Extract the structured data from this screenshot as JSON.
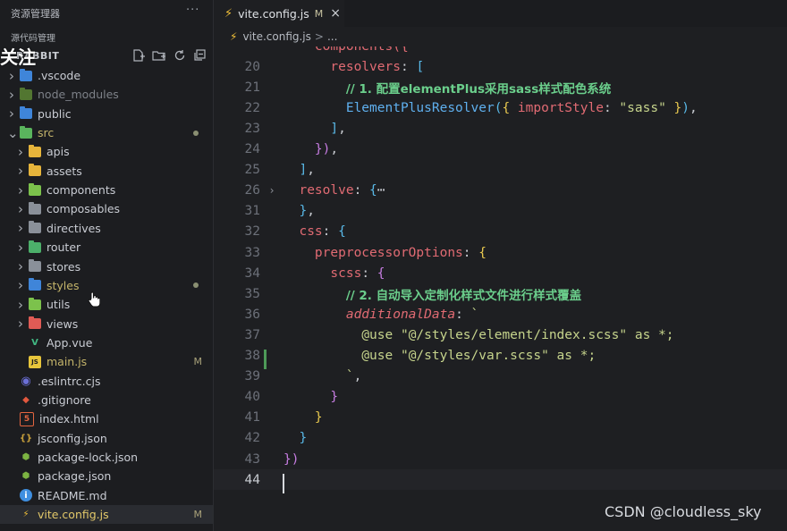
{
  "sidebar": {
    "title": "资源管理器",
    "more": "···",
    "source_control": "源代码管理",
    "overlay_follow": "关注",
    "project": "RABBIT",
    "tree": [
      {
        "label": ".vscode",
        "type": "folder",
        "depth": 0,
        "expanded": false,
        "color": "#3f85d9",
        "dim": false
      },
      {
        "label": "node_modules",
        "type": "folder",
        "depth": 0,
        "expanded": false,
        "color": "#7fbf3f",
        "dim": true
      },
      {
        "label": "public",
        "type": "folder",
        "depth": 0,
        "expanded": false,
        "color": "#3f85d9",
        "dim": false
      },
      {
        "label": "src",
        "type": "folder",
        "depth": 0,
        "expanded": true,
        "color": "#5ab55d",
        "dim": false,
        "status": "dot",
        "accent": "#c4b46a"
      },
      {
        "label": "apis",
        "type": "folder",
        "depth": 1,
        "expanded": false,
        "color": "#e7b53b",
        "dim": false
      },
      {
        "label": "assets",
        "type": "folder",
        "depth": 1,
        "expanded": false,
        "color": "#e7b53b",
        "dim": false
      },
      {
        "label": "components",
        "type": "folder",
        "depth": 1,
        "expanded": false,
        "color": "#7cc24c",
        "dim": false
      },
      {
        "label": "composables",
        "type": "folder",
        "depth": 1,
        "expanded": false,
        "color": "#8a9099",
        "dim": false
      },
      {
        "label": "directives",
        "type": "folder",
        "depth": 1,
        "expanded": false,
        "color": "#8a9099",
        "dim": false
      },
      {
        "label": "router",
        "type": "folder",
        "depth": 1,
        "expanded": false,
        "color": "#4caf6a",
        "dim": false
      },
      {
        "label": "stores",
        "type": "folder",
        "depth": 1,
        "expanded": false,
        "color": "#8a9099",
        "dim": false
      },
      {
        "label": "styles",
        "type": "folder",
        "depth": 1,
        "expanded": false,
        "color": "#3f85d9",
        "dim": false,
        "status": "dot",
        "accent": "#c4b46a"
      },
      {
        "label": "utils",
        "type": "folder",
        "depth": 1,
        "expanded": false,
        "color": "#7cc24c",
        "dim": false
      },
      {
        "label": "views",
        "type": "folder",
        "depth": 1,
        "expanded": false,
        "color": "#e05b55",
        "dim": false
      },
      {
        "label": "App.vue",
        "type": "file",
        "depth": 1,
        "icon": "V",
        "color": "#41b883",
        "dim": false
      },
      {
        "label": "main.js",
        "type": "file",
        "depth": 1,
        "icon": "JS",
        "color": "#e7c53b",
        "dim": false,
        "status": "M",
        "accent": "#c4b46a"
      },
      {
        "label": ".eslintrc.cjs",
        "type": "file",
        "depth": 0,
        "icon": "◉",
        "color": "#6b6fd6",
        "dim": false
      },
      {
        "label": ".gitignore",
        "type": "file",
        "depth": 0,
        "icon": "◆",
        "color": "#e2583e",
        "dim": false
      },
      {
        "label": "index.html",
        "type": "file",
        "depth": 0,
        "icon": "5",
        "color": "#e3653f",
        "dim": false
      },
      {
        "label": "jsconfig.json",
        "type": "file",
        "depth": 0,
        "icon": "{}",
        "color": "#c9a13b",
        "dim": false
      },
      {
        "label": "package-lock.json",
        "type": "file",
        "depth": 0,
        "icon": "⬢",
        "color": "#7cb342",
        "dim": false
      },
      {
        "label": "package.json",
        "type": "file",
        "depth": 0,
        "icon": "⬢",
        "color": "#7cb342",
        "dim": false
      },
      {
        "label": "README.md",
        "type": "file",
        "depth": 0,
        "icon": "i",
        "color": "#3f8fe0",
        "dim": false
      },
      {
        "label": "vite.config.js",
        "type": "file",
        "depth": 0,
        "icon": "⚡",
        "color": "#f2c038",
        "dim": false,
        "status": "M",
        "accent": "#e3c96a",
        "selected": true
      }
    ]
  },
  "tab": {
    "label": "vite.config.js",
    "modified": "M",
    "close": "×"
  },
  "breadcrumb": {
    "file": "vite.config.js",
    "sep": ">",
    "rest": "..."
  },
  "code_lines": [
    {
      "n": "",
      "tokens": [
        [
          "    components({",
          "k"
        ]
      ]
    },
    {
      "n": "20",
      "tokens": [
        [
          "      ",
          "p"
        ],
        [
          "resolvers",
          "k"
        ],
        [
          ": ",
          "p"
        ],
        [
          "[",
          "b3"
        ]
      ]
    },
    {
      "n": "21",
      "tokens": [
        [
          "        ",
          "p"
        ],
        [
          "// 1. 配置elementPlus采用sass样式配色系统",
          "c"
        ]
      ]
    },
    {
      "n": "22",
      "tokens": [
        [
          "        ",
          "p"
        ],
        [
          "ElementPlusResolver",
          "fn"
        ],
        [
          "(",
          "b3"
        ],
        [
          "{",
          "b1"
        ],
        [
          " ",
          "p"
        ],
        [
          "importStyle",
          "k"
        ],
        [
          ": ",
          "p"
        ],
        [
          "\"sass\"",
          "s"
        ],
        [
          " ",
          "p"
        ],
        [
          "}",
          "b1"
        ],
        [
          ")",
          "b3"
        ],
        [
          ",",
          "p"
        ]
      ]
    },
    {
      "n": "23",
      "tokens": [
        [
          "      ",
          "p"
        ],
        [
          "]",
          "b3"
        ],
        [
          ",",
          "p"
        ]
      ]
    },
    {
      "n": "24",
      "tokens": [
        [
          "    ",
          "p"
        ],
        [
          "}",
          "b2"
        ],
        [
          ")",
          "b2"
        ],
        [
          ",",
          "p"
        ]
      ]
    },
    {
      "n": "25",
      "tokens": [
        [
          "  ",
          "p"
        ],
        [
          "]",
          "b3"
        ],
        [
          ",",
          "p"
        ]
      ]
    },
    {
      "n": "26",
      "fold": "›",
      "tokens": [
        [
          "  ",
          "p"
        ],
        [
          "resolve",
          "k"
        ],
        [
          ": ",
          "p"
        ],
        [
          "{",
          "b3"
        ],
        [
          "⋯",
          "p"
        ]
      ]
    },
    {
      "n": "31",
      "tokens": [
        [
          "  ",
          "p"
        ],
        [
          "}",
          "b3"
        ],
        [
          ",",
          "p"
        ]
      ]
    },
    {
      "n": "32",
      "tokens": [
        [
          "  ",
          "p"
        ],
        [
          "css",
          "k"
        ],
        [
          ": ",
          "p"
        ],
        [
          "{",
          "b3"
        ]
      ]
    },
    {
      "n": "33",
      "tokens": [
        [
          "    ",
          "p"
        ],
        [
          "preprocessorOptions",
          "k"
        ],
        [
          ": ",
          "p"
        ],
        [
          "{",
          "b1"
        ]
      ]
    },
    {
      "n": "34",
      "tokens": [
        [
          "      ",
          "p"
        ],
        [
          "scss",
          "k"
        ],
        [
          ": ",
          "p"
        ],
        [
          "{",
          "b2"
        ]
      ]
    },
    {
      "n": "35",
      "tokens": [
        [
          "        ",
          "p"
        ],
        [
          "// 2. 自动导入定制化样式文件进行样式覆盖",
          "c"
        ]
      ]
    },
    {
      "n": "36",
      "tokens": [
        [
          "        ",
          "p"
        ],
        [
          "additionalData",
          "k it"
        ],
        [
          ": ",
          "p"
        ],
        [
          "`",
          "s"
        ]
      ]
    },
    {
      "n": "37",
      "tokens": [
        [
          "          ",
          "p"
        ],
        [
          "@use \"@/styles/element/index.scss\" as *;",
          "s"
        ]
      ]
    },
    {
      "n": "38",
      "tokens": [
        [
          "          ",
          "p"
        ],
        [
          "@use \"@/styles/var.scss\" as *;",
          "s"
        ]
      ]
    },
    {
      "n": "39",
      "tokens": [
        [
          "        ",
          "p"
        ],
        [
          "`",
          "s"
        ],
        [
          ",",
          "p"
        ]
      ]
    },
    {
      "n": "40",
      "tokens": [
        [
          "      ",
          "p"
        ],
        [
          "}",
          "b2"
        ]
      ]
    },
    {
      "n": "41",
      "tokens": [
        [
          "    ",
          "p"
        ],
        [
          "}",
          "b1"
        ]
      ]
    },
    {
      "n": "42",
      "tokens": [
        [
          "  ",
          "p"
        ],
        [
          "}",
          "b3"
        ]
      ]
    },
    {
      "n": "43",
      "tokens": [
        [
          "}",
          "b2"
        ],
        [
          ")",
          "b2"
        ]
      ]
    },
    {
      "n": "44",
      "current": true,
      "tokens": [
        [
          "",
          "p"
        ]
      ]
    }
  ],
  "watermark": "CSDN @cloudless_sky"
}
